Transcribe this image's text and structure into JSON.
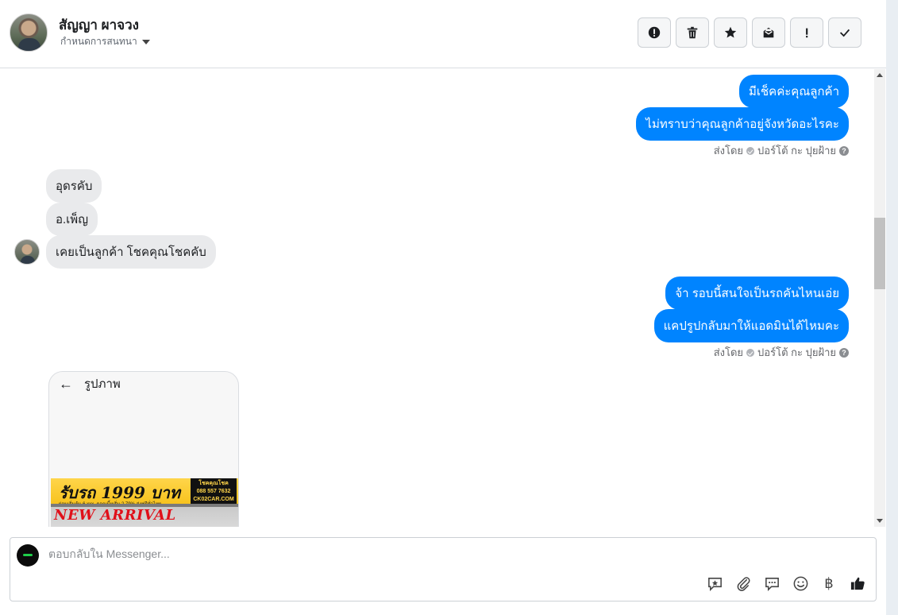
{
  "header": {
    "contact_name": "สัญญา ผาจวง",
    "assign_label": "กำหนดการสนทนา"
  },
  "toolbar": {
    "buttons": [
      "spam-icon",
      "trash-icon",
      "star-icon",
      "unread-icon",
      "important-icon",
      "check-icon"
    ]
  },
  "messages": {
    "out_1": "มีเช็คค่ะคุณลูกค้า",
    "out_2": "ไม่ทราบว่าคุณลูกค้าอยู่จังหวัดอะไรคะ",
    "sent_by_1": "ส่งโดย",
    "sent_by_name_1": "ปอร์โต้ กะ ปุยฝ้าย",
    "in_1": "อุดรคับ",
    "in_2": "อ.เพ็ญ",
    "in_3": "เคยเป็นลูกค้า โชคคุณโชคคับ",
    "out_3": "จ้า รอบนี้สนใจเป็นรถคันไหนเอ่ย",
    "out_4": "แคปรูปกลับมาให้แอดมินได้ไหมคะ",
    "sent_by_2": "ส่งโดย",
    "sent_by_name_2": "ปอร์โต้ กะ ปุยฝ้าย",
    "image_card_title": "รูปภาพ"
  },
  "promo": {
    "headline": "รับรถ 1999 บาท",
    "subline": "ผ่อนเริ่มต้น 6,xxx.   ดอกเบี้ยเริ่ม 2.79%   ส่งฟรีทั่วไทย",
    "logo_text": "โชคคุณโชค",
    "phone": "088 557 7632",
    "site": "CK02CAR.COM",
    "banner": "NEW ARRIVAL"
  },
  "composer": {
    "placeholder": "ตอบกลับใน Messenger..."
  }
}
